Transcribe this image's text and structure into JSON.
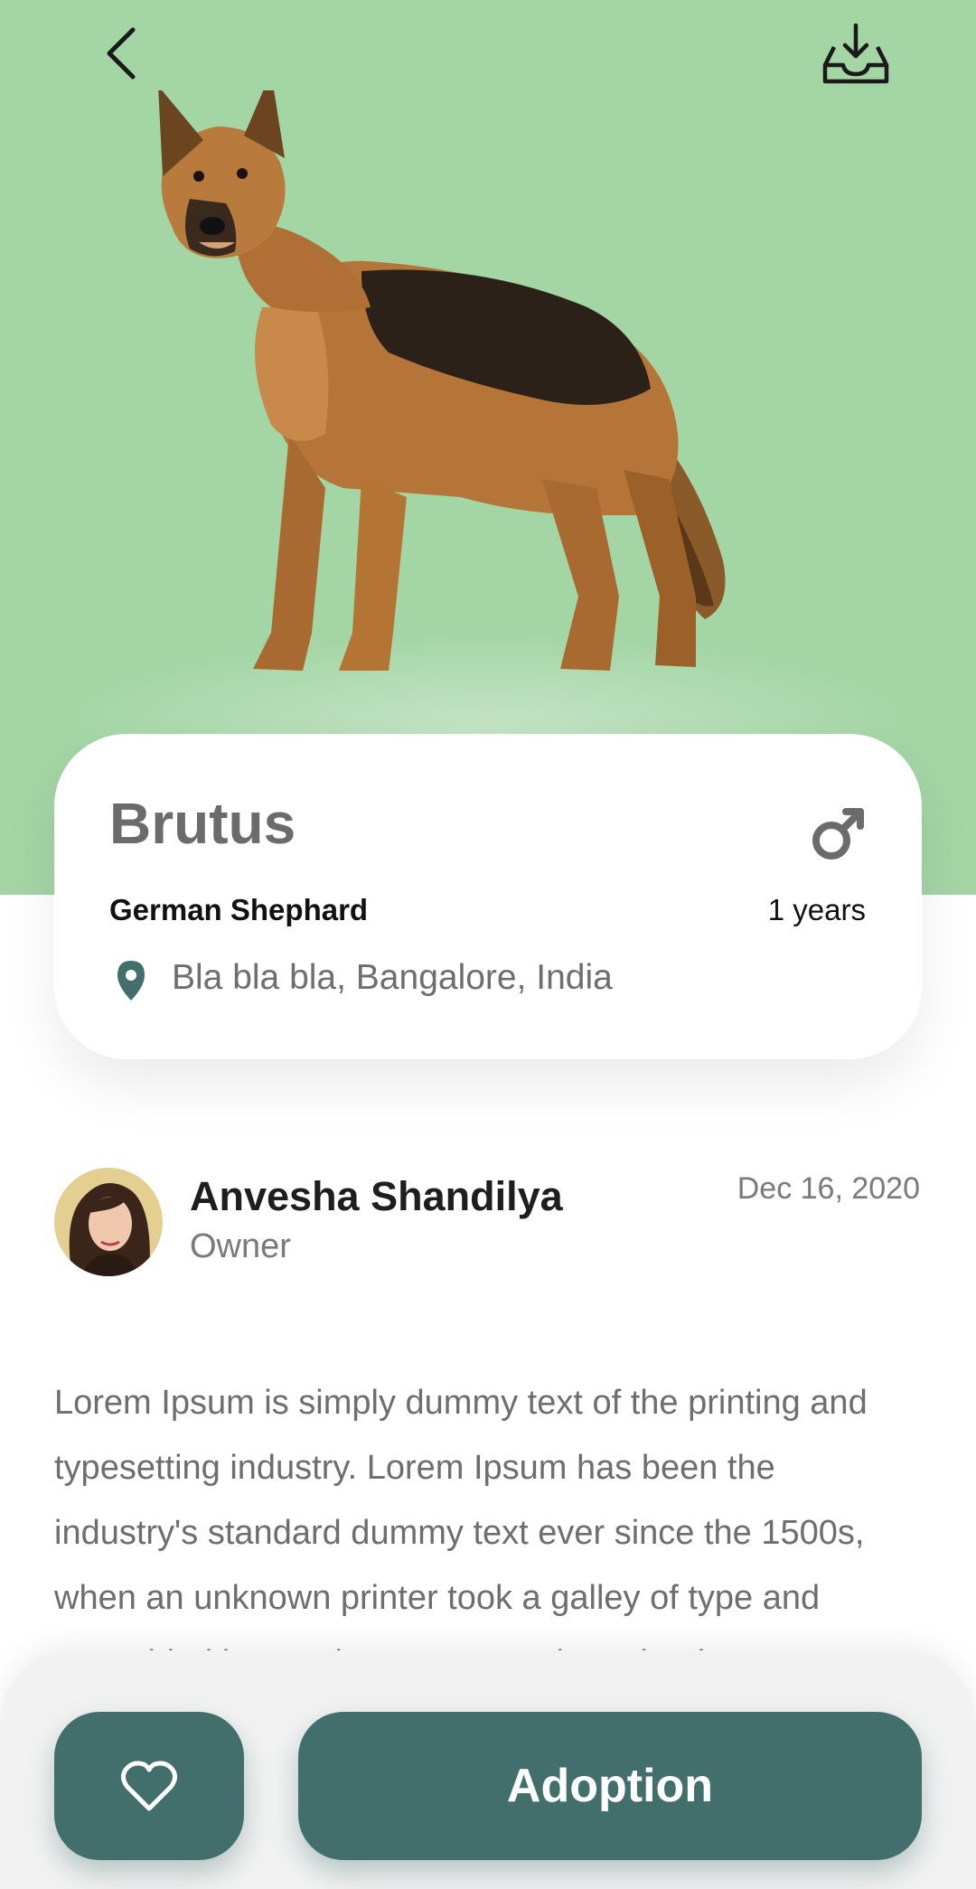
{
  "header": {
    "back_icon": "chevron-left-icon",
    "download_icon": "inbox-download-icon",
    "hero_color": "#a4d5a5"
  },
  "pet": {
    "name": "Brutus",
    "breed": "German Shephard",
    "age": "1 years",
    "gender_icon": "male-icon",
    "location": "Bla bla bla, Bangalore, India"
  },
  "owner": {
    "name": "Anvesha Shandilya",
    "role": "Owner",
    "date": "Dec 16, 2020"
  },
  "description": "Lorem Ipsum is simply dummy text of the printing and typesetting industry. Lorem Ipsum has been the industry's standard dummy text ever since the 1500s, when an unknown printer took a galley of type and scrambled it to make a type specimen book.",
  "actions": {
    "favorite_icon": "heart-icon",
    "adopt_label": "Adoption",
    "accent_color": "#426f6c"
  }
}
